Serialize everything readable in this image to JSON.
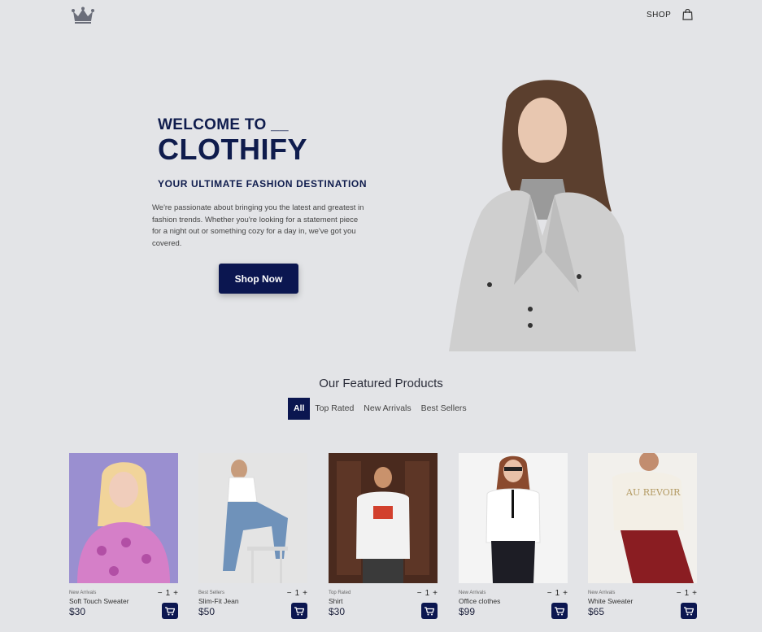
{
  "nav": {
    "shop_label": "SHOP",
    "logo_icon": "crown-icon",
    "cart_icon": "shopping-bag-icon"
  },
  "hero": {
    "welcome": "WELCOME TO __",
    "brand": "CLOTHIFY",
    "tagline": "YOUR ULTIMATE FASHION DESTINATION",
    "description": "We're passionate about bringing you the latest and greatest in fashion trends. Whether you're looking for a statement piece for a night out or something cozy for a day in, we've got you covered.",
    "cta_label": "Shop Now"
  },
  "featured": {
    "title": "Our Featured Products",
    "filters": [
      "All",
      "Top Rated",
      "New Arrivals",
      "Best Sellers"
    ],
    "active_filter": "All"
  },
  "products": [
    {
      "category": "New Arrivals",
      "name": "Soft Touch Sweater",
      "price": "$30",
      "qty": "1"
    },
    {
      "category": "Best Sellers",
      "name": "Slim-Fit Jean",
      "price": "$50",
      "qty": "1"
    },
    {
      "category": "Top Rated",
      "name": "Shirt",
      "price": "$30",
      "qty": "1"
    },
    {
      "category": "New Arrivals",
      "name": "Office clothes",
      "price": "$99",
      "qty": "1"
    },
    {
      "category": "New Arrivals",
      "name": "White Sweater",
      "price": "$65",
      "qty": "1"
    }
  ],
  "colors": {
    "primary": "#0b1650",
    "background": "#e3e4e7",
    "heading": "#0f1c4d"
  }
}
